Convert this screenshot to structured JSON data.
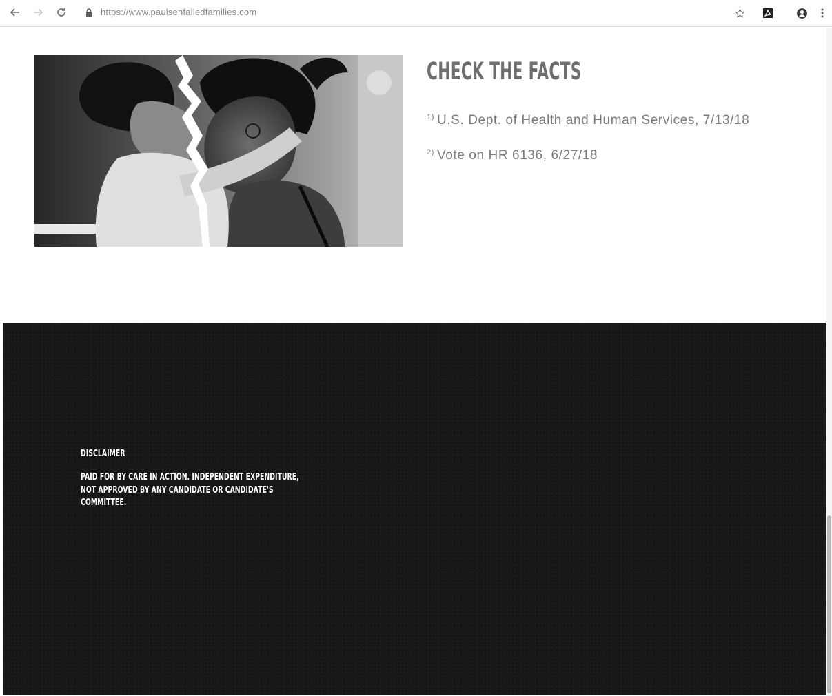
{
  "browser": {
    "url": "https://www.paulsenfailedfamilies.com",
    "icons": [
      "back-arrow-icon",
      "forward-arrow-icon",
      "reload-icon",
      "lock-icon",
      "star-icon",
      "pdf-extension-icon",
      "account-icon",
      "menu-dots-icon"
    ]
  },
  "hero": {
    "image": "black-and-white photo of mother and child split by a torn crack"
  },
  "facts": {
    "heading": "CHECK THE FACTS",
    "items": [
      {
        "marker": "1)",
        "text": "U.S. Dept. of Health and Human Services, 7/13/18"
      },
      {
        "marker": "2)",
        "text": "Vote on HR 6136, 6/27/18"
      }
    ]
  },
  "footer": {
    "disclaimer_title": "DISCLAIMER",
    "disclaimer_text": "PAID FOR BY CARE IN ACTION. INDEPENDENT EXPENDITURE, NOT APPROVED BY ANY CANDIDATE OR CANDIDATE'S COMMITTEE.",
    "background_color": "#171717"
  }
}
